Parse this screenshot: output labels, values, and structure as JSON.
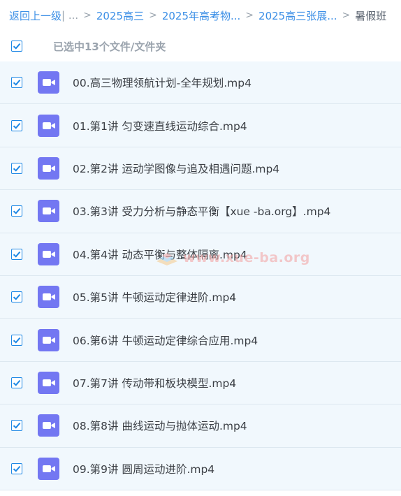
{
  "breadcrumb": {
    "back": "返回上一级",
    "divider": " | ...",
    "items": [
      "2025高三",
      "2025年高考物...",
      "2025高三张展..."
    ],
    "current": "暑假班",
    "separator": ">"
  },
  "selection": {
    "text": "已选中13个文件/文件夹",
    "checked": true
  },
  "files": [
    {
      "name": "00.高三物理领航计划-全年规划.mp4",
      "checked": true
    },
    {
      "name": "01.第1讲 匀变速直线运动综合.mp4",
      "checked": true
    },
    {
      "name": "02.第2讲 运动学图像与追及相遇问题.mp4",
      "checked": true
    },
    {
      "name": "03.第3讲 受力分析与静态平衡【xue -ba.org】.mp4",
      "checked": true
    },
    {
      "name": "04.第4讲 动态平衡与整体隔离.mp4",
      "checked": true
    },
    {
      "name": "05.第5讲 牛顿运动定律进阶.mp4",
      "checked": true
    },
    {
      "name": "06.第6讲 牛顿运动定律综合应用.mp4",
      "checked": true
    },
    {
      "name": "07.第7讲 传动带和板块模型.mp4",
      "checked": true
    },
    {
      "name": "08.第8讲 曲线运动与抛体运动.mp4",
      "checked": true
    },
    {
      "name": "09.第9讲 圆周运动进阶.mp4",
      "checked": true
    }
  ],
  "watermark": "www.xue-ba.org",
  "colors": {
    "link": "#3a8ee6",
    "checkbox": "#1e88e5",
    "video_icon": "#7377f2",
    "row_bg": "#f1f8fd"
  },
  "icons": {
    "checkbox": "checkmark",
    "file": "video-camera-icon"
  }
}
